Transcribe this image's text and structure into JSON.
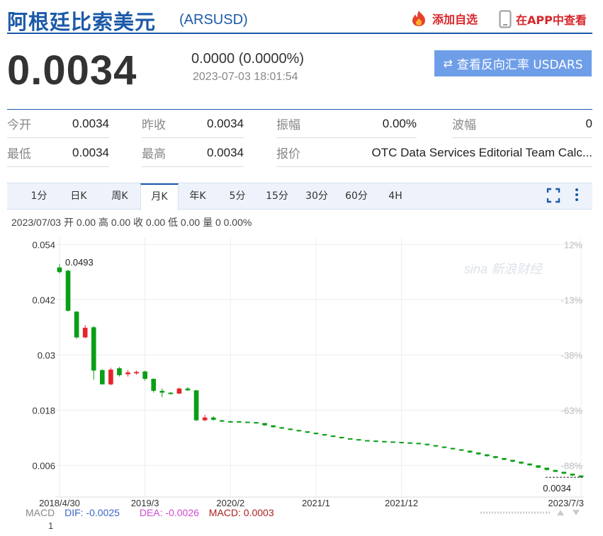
{
  "header": {
    "title": "阿根廷比索美元",
    "code": "(ARSUSD)",
    "favorite_label": "添加自选",
    "app_label": "在APP中查看",
    "brand_color": "#1c5aa8",
    "alert_color": "#d7262b"
  },
  "quote": {
    "price": "0.0034",
    "change": "0.0000 (0.0000%)",
    "timestamp": "2023-07-03 18:01:54",
    "reverse_button": "查看反向汇率 USDARS"
  },
  "stats": [
    [
      {
        "label": "今开",
        "value": "0.0034"
      },
      {
        "label": "昨收",
        "value": "0.0034"
      },
      {
        "label": "振幅",
        "value": "0.00%"
      },
      {
        "label": "波幅",
        "value": "0"
      }
    ],
    [
      {
        "label": "最低",
        "value": "0.0034"
      },
      {
        "label": "最高",
        "value": "0.0034"
      },
      {
        "label": "报价",
        "value": "OTC Data Services Editorial Team Calc..."
      }
    ]
  ],
  "tabs": [
    "1分",
    "日K",
    "周K",
    "月K",
    "年K",
    "5分",
    "15分",
    "30分",
    "60分",
    "4H"
  ],
  "active_tab": "月K",
  "ohlc_line": "2023/07/03 开 0.00 高 0.00 收 0.00 低 0.00 量 0 0.00%",
  "watermark": "sina 新浪财经",
  "macd": {
    "title": "MACD",
    "dif": "DIF: -0.0025",
    "dea": "DEA: -0.0026",
    "macd": "MACD: 0.0003",
    "axis_label": "1"
  },
  "chart_data": {
    "type": "candlestick",
    "yticks": [
      "0.054",
      "0.042",
      "0.03",
      "0.018",
      "0.006"
    ],
    "ytick_values": [
      0.054,
      0.042,
      0.03,
      0.018,
      0.006
    ],
    "right_ticks": [
      "12%",
      "-13%",
      "-38%",
      "-63%",
      "-88%"
    ],
    "xticks": [
      "2018/4/30",
      "2019/3",
      "2020/2",
      "2021/1",
      "2021/12",
      "2023/7/3"
    ],
    "xtick_index": [
      0,
      10,
      20,
      30,
      40,
      61
    ],
    "ylim": [
      0.0025,
      0.0545
    ],
    "max_label": "0.0493",
    "last_label": "0.0034",
    "up_color": "#e3262c",
    "down_color": "#0a9f16",
    "candles": [
      {
        "o": 0.049,
        "h": 0.0497,
        "l": 0.0477,
        "c": 0.048
      },
      {
        "o": 0.0483,
        "h": 0.0485,
        "l": 0.0394,
        "c": 0.0396
      },
      {
        "o": 0.0394,
        "h": 0.0395,
        "l": 0.0335,
        "c": 0.0338
      },
      {
        "o": 0.0338,
        "h": 0.0365,
        "l": 0.0336,
        "c": 0.0359
      },
      {
        "o": 0.036,
        "h": 0.0363,
        "l": 0.0246,
        "c": 0.0266
      },
      {
        "o": 0.0267,
        "h": 0.0269,
        "l": 0.0247,
        "c": 0.0236
      },
      {
        "o": 0.0236,
        "h": 0.0272,
        "l": 0.0234,
        "c": 0.0268
      },
      {
        "o": 0.0271,
        "h": 0.0274,
        "l": 0.0253,
        "c": 0.0256
      },
      {
        "o": 0.0258,
        "h": 0.0267,
        "l": 0.0253,
        "c": 0.0262
      },
      {
        "o": 0.0261,
        "h": 0.0266,
        "l": 0.0257,
        "c": 0.0263
      },
      {
        "o": 0.0264,
        "h": 0.0266,
        "l": 0.0244,
        "c": 0.0248
      },
      {
        "o": 0.0248,
        "h": 0.0249,
        "l": 0.0218,
        "c": 0.0222
      },
      {
        "o": 0.0222,
        "h": 0.0227,
        "l": 0.0208,
        "c": 0.0218
      },
      {
        "o": 0.0218,
        "h": 0.0219,
        "l": 0.0214,
        "c": 0.0216
      },
      {
        "o": 0.0216,
        "h": 0.0229,
        "l": 0.0215,
        "c": 0.0227
      },
      {
        "o": 0.0227,
        "h": 0.023,
        "l": 0.0222,
        "c": 0.0223
      },
      {
        "o": 0.0223,
        "h": 0.0224,
        "l": 0.0156,
        "c": 0.0158
      },
      {
        "o": 0.0158,
        "h": 0.017,
        "l": 0.0156,
        "c": 0.0164
      },
      {
        "o": 0.0164,
        "h": 0.0167,
        "l": 0.0157,
        "c": 0.0159
      },
      {
        "o": 0.0158,
        "h": 0.0159,
        "l": 0.0156,
        "c": 0.0157
      },
      {
        "o": 0.0156,
        "h": 0.0157,
        "l": 0.0155,
        "c": 0.0156
      },
      {
        "o": 0.0156,
        "h": 0.0156,
        "l": 0.0154,
        "c": 0.0155
      },
      {
        "o": 0.0155,
        "h": 0.0155,
        "l": 0.0154,
        "c": 0.0154
      },
      {
        "o": 0.0154,
        "h": 0.0154,
        "l": 0.0151,
        "c": 0.0152
      },
      {
        "o": 0.0152,
        "h": 0.0152,
        "l": 0.0146,
        "c": 0.0147
      },
      {
        "o": 0.0147,
        "h": 0.0147,
        "l": 0.0142,
        "c": 0.0143
      },
      {
        "o": 0.0143,
        "h": 0.0143,
        "l": 0.0139,
        "c": 0.014
      },
      {
        "o": 0.014,
        "h": 0.014,
        "l": 0.0136,
        "c": 0.0137
      },
      {
        "o": 0.0137,
        "h": 0.0137,
        "l": 0.0133,
        "c": 0.0134
      },
      {
        "o": 0.0134,
        "h": 0.0134,
        "l": 0.013,
        "c": 0.0131
      },
      {
        "o": 0.0131,
        "h": 0.0131,
        "l": 0.0127,
        "c": 0.0128
      },
      {
        "o": 0.0128,
        "h": 0.0128,
        "l": 0.0124,
        "c": 0.0125
      },
      {
        "o": 0.0125,
        "h": 0.0125,
        "l": 0.0121,
        "c": 0.0122
      },
      {
        "o": 0.0122,
        "h": 0.0122,
        "l": 0.0118,
        "c": 0.0119
      },
      {
        "o": 0.0119,
        "h": 0.0119,
        "l": 0.0116,
        "c": 0.0117
      },
      {
        "o": 0.0117,
        "h": 0.0117,
        "l": 0.0114,
        "c": 0.0115
      },
      {
        "o": 0.0115,
        "h": 0.0115,
        "l": 0.0113,
        "c": 0.0114
      },
      {
        "o": 0.0114,
        "h": 0.0114,
        "l": 0.0112,
        "c": 0.0113
      },
      {
        "o": 0.0113,
        "h": 0.0113,
        "l": 0.0111,
        "c": 0.0112
      },
      {
        "o": 0.0112,
        "h": 0.0112,
        "l": 0.011,
        "c": 0.0111
      },
      {
        "o": 0.0111,
        "h": 0.0111,
        "l": 0.0109,
        "c": 0.011
      },
      {
        "o": 0.011,
        "h": 0.011,
        "l": 0.0108,
        "c": 0.0109
      },
      {
        "o": 0.0109,
        "h": 0.0109,
        "l": 0.0106,
        "c": 0.0107
      },
      {
        "o": 0.0107,
        "h": 0.0107,
        "l": 0.0103,
        "c": 0.0104
      },
      {
        "o": 0.0104,
        "h": 0.0104,
        "l": 0.01,
        "c": 0.0101
      },
      {
        "o": 0.0101,
        "h": 0.0101,
        "l": 0.0097,
        "c": 0.0098
      },
      {
        "o": 0.0098,
        "h": 0.0098,
        "l": 0.0094,
        "c": 0.0095
      },
      {
        "o": 0.0095,
        "h": 0.0095,
        "l": 0.0091,
        "c": 0.0092
      },
      {
        "o": 0.0092,
        "h": 0.0092,
        "l": 0.0087,
        "c": 0.0088
      },
      {
        "o": 0.0088,
        "h": 0.0088,
        "l": 0.0083,
        "c": 0.0084
      },
      {
        "o": 0.0084,
        "h": 0.0084,
        "l": 0.0079,
        "c": 0.008
      },
      {
        "o": 0.008,
        "h": 0.008,
        "l": 0.0075,
        "c": 0.0076
      },
      {
        "o": 0.0076,
        "h": 0.0076,
        "l": 0.0071,
        "c": 0.0072
      },
      {
        "o": 0.0072,
        "h": 0.0072,
        "l": 0.0067,
        "c": 0.0068
      },
      {
        "o": 0.0068,
        "h": 0.0068,
        "l": 0.0063,
        "c": 0.0064
      },
      {
        "o": 0.0064,
        "h": 0.0064,
        "l": 0.0059,
        "c": 0.006
      },
      {
        "o": 0.006,
        "h": 0.006,
        "l": 0.0054,
        "c": 0.0055
      },
      {
        "o": 0.0055,
        "h": 0.0055,
        "l": 0.0049,
        "c": 0.005
      },
      {
        "o": 0.005,
        "h": 0.005,
        "l": 0.0045,
        "c": 0.0046
      },
      {
        "o": 0.0046,
        "h": 0.0046,
        "l": 0.0041,
        "c": 0.0042
      },
      {
        "o": 0.0042,
        "h": 0.0042,
        "l": 0.0037,
        "c": 0.0038
      },
      {
        "o": 0.0038,
        "h": 0.0038,
        "l": 0.0033,
        "c": 0.0034
      }
    ]
  }
}
